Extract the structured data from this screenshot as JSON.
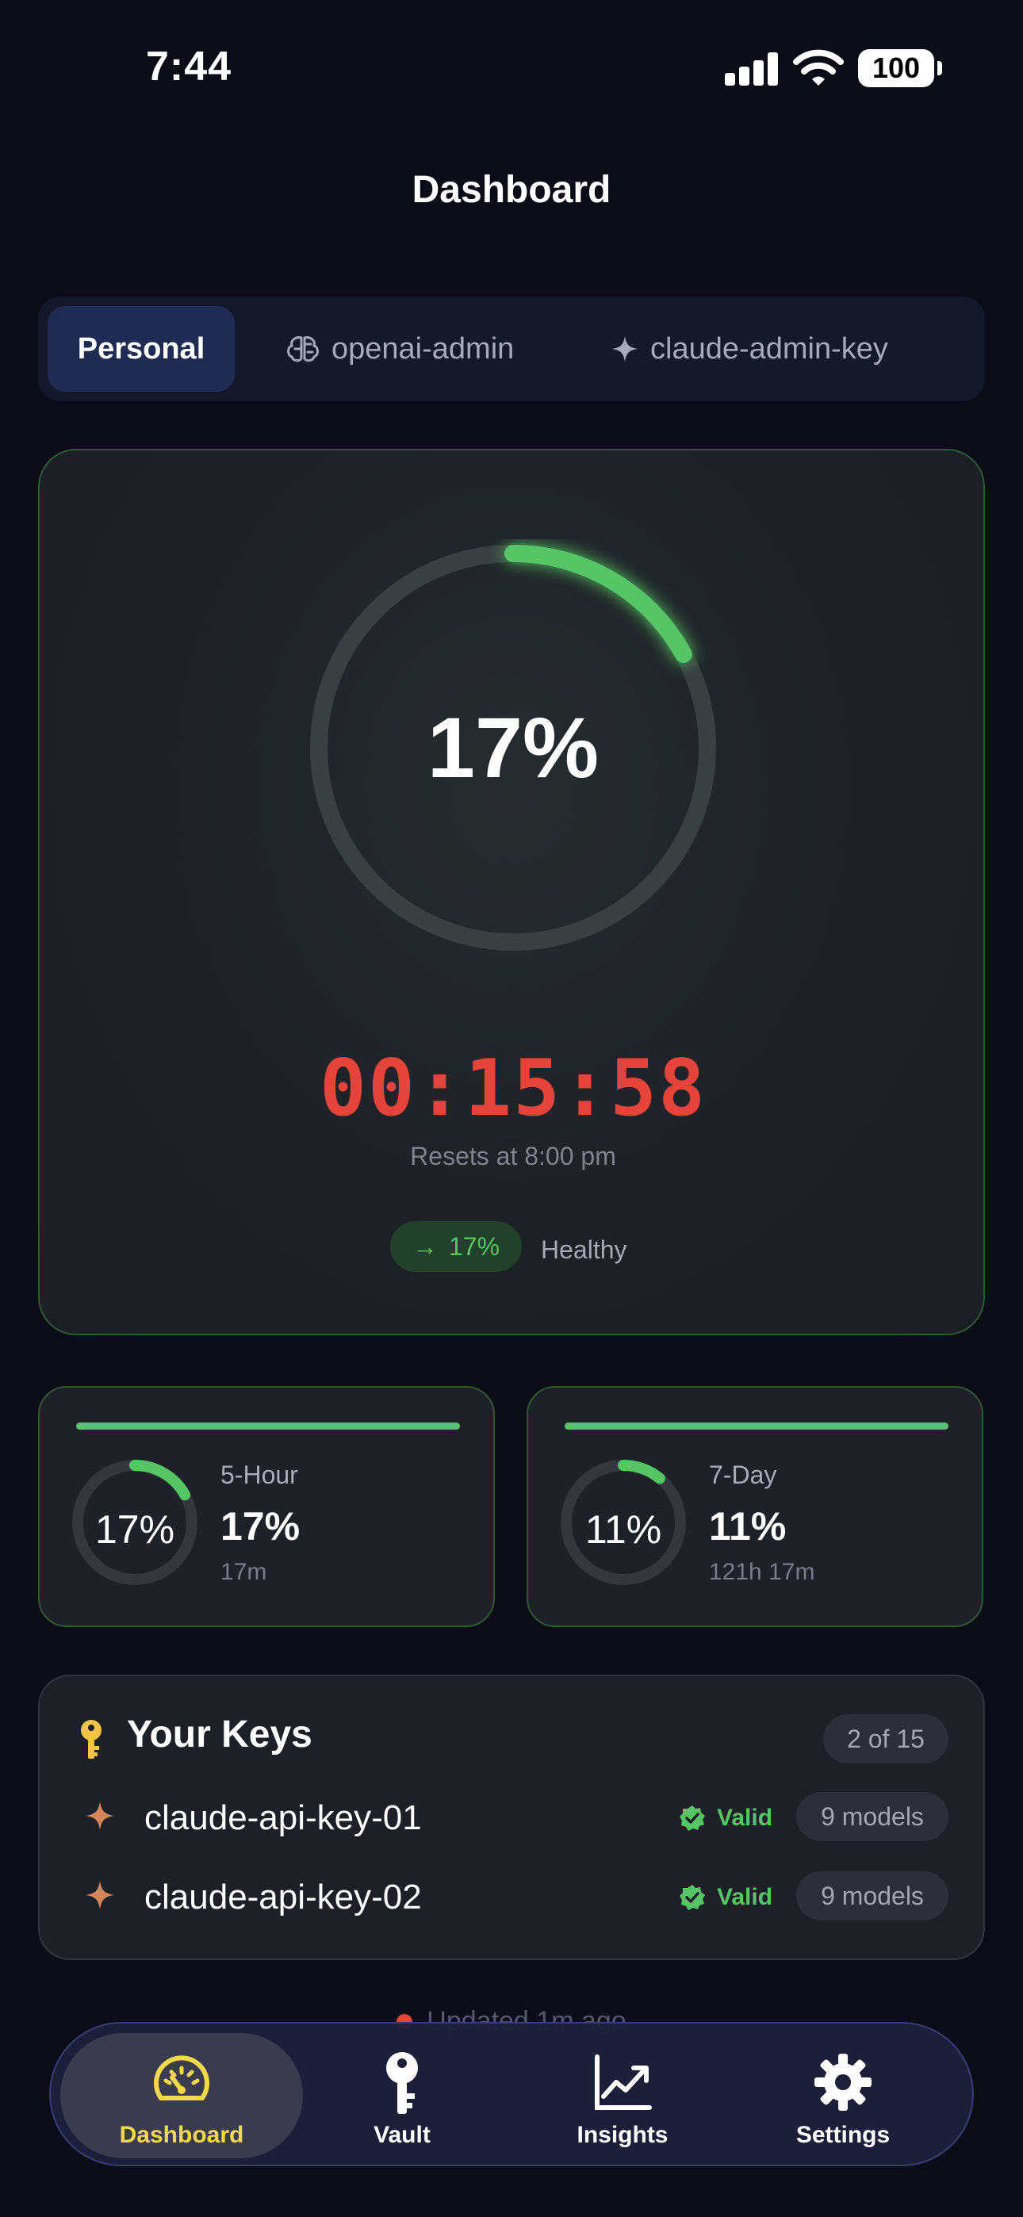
{
  "status_bar": {
    "time": "7:44",
    "battery": "100"
  },
  "header": {
    "title": "Dashboard"
  },
  "accounts": {
    "tabs": [
      {
        "label": "Personal",
        "icon": "none",
        "active": true
      },
      {
        "label": "openai-admin",
        "icon": "brain-icon",
        "active": false
      },
      {
        "label": "claude-admin-key",
        "icon": "sparkle-icon",
        "active": false
      }
    ]
  },
  "usage": {
    "percent_text": "17%",
    "percent": 17,
    "countdown": "00:15:58",
    "reset_text": "Resets at 8:00 pm",
    "trend": {
      "arrow": "→",
      "value": "17%"
    },
    "health": "Healthy"
  },
  "windows": [
    {
      "label": "5-Hour",
      "percent_text": "17%",
      "value": "17%",
      "sub": "17m",
      "percent": 17
    },
    {
      "label": "7-Day",
      "percent_text": "11%",
      "value": "11%",
      "sub": "121h 17m",
      "percent": 11
    }
  ],
  "keys": {
    "title": "Your Keys",
    "count": "2 of 15",
    "items": [
      {
        "name": "claude-api-key-01",
        "status": "Valid",
        "models": "9 models"
      },
      {
        "name": "claude-api-key-02",
        "status": "Valid",
        "models": "9 models"
      }
    ]
  },
  "updated": "Updated 1m ago",
  "nav": {
    "items": [
      {
        "label": "Dashboard",
        "icon": "speedometer-icon",
        "active": true
      },
      {
        "label": "Vault",
        "icon": "key-icon",
        "active": false
      },
      {
        "label": "Insights",
        "icon": "chart-icon",
        "active": false
      },
      {
        "label": "Settings",
        "icon": "gear-icon",
        "active": false
      }
    ]
  },
  "colors": {
    "accent_green": "#55c565",
    "danger_red": "#e6443a",
    "nav_active_yellow": "#f5d94a",
    "background": "#0b0c18"
  }
}
